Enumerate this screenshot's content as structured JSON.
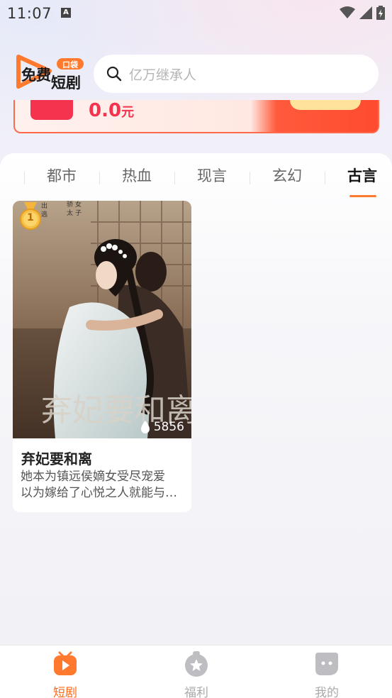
{
  "status_bar": {
    "time": "11:07",
    "notification_letter": "A"
  },
  "header": {
    "logo_text_line1": "免费",
    "logo_text_line2": "短剧",
    "logo_tag": "口袋",
    "search_placeholder": "亿万继承人"
  },
  "banner": {
    "amount": "0.0",
    "unit": "元"
  },
  "category_tabs": [
    {
      "label": "都市",
      "active": false
    },
    {
      "label": "热血",
      "active": false
    },
    {
      "label": "现言",
      "active": false
    },
    {
      "label": "玄幻",
      "active": false
    },
    {
      "label": "古言",
      "active": true
    }
  ],
  "dramas": [
    {
      "rank": "1",
      "title": "弃妃要和离",
      "plays": "5856",
      "desc_line1": "她本为镇远侯嫡女受尽宠爱",
      "desc_line2": "以为嫁给了心悦之人就能与…",
      "poster_calligraphy": "弃妃要和离"
    }
  ],
  "bottom_nav": [
    {
      "label": "短剧",
      "icon": "drama-tv-icon",
      "active": true
    },
    {
      "label": "福利",
      "icon": "welfare-star-icon",
      "active": false
    },
    {
      "label": "我的",
      "icon": "profile-face-icon",
      "active": false
    }
  ],
  "colors": {
    "accent": "#ff6a1a",
    "banner_red": "#f4344f",
    "text_primary": "#222222"
  }
}
